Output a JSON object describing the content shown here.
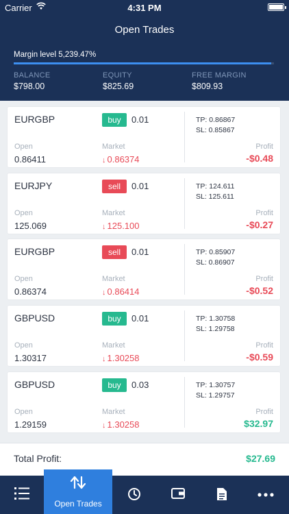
{
  "status": {
    "carrier": "Carrier",
    "time": "4:31 PM"
  },
  "header": {
    "title": "Open Trades",
    "margin_label": "Margin level 5,239.47%",
    "margin_fill_percent": 99,
    "stats": [
      {
        "label": "BALANCE",
        "value": "$798.00"
      },
      {
        "label": "EQUITY",
        "value": "$825.69"
      },
      {
        "label": "FREE MARGIN",
        "value": "$809.93"
      }
    ]
  },
  "labels": {
    "open": "Open",
    "market": "Market",
    "profit": "Profit"
  },
  "trades": [
    {
      "symbol": "EURGBP",
      "side": "buy",
      "lots": "0.01",
      "tp": "TP: 0.86867",
      "sl": "SL: 0.85867",
      "open": "0.86411",
      "market": "0.86374",
      "profit": "-$0.48",
      "profit_sign": "neg"
    },
    {
      "symbol": "EURJPY",
      "side": "sell",
      "lots": "0.01",
      "tp": "TP: 124.611",
      "sl": "SL: 125.611",
      "open": "125.069",
      "market": "125.100",
      "profit": "-$0.27",
      "profit_sign": "neg"
    },
    {
      "symbol": "EURGBP",
      "side": "sell",
      "lots": "0.01",
      "tp": "TP: 0.85907",
      "sl": "SL: 0.86907",
      "open": "0.86374",
      "market": "0.86414",
      "profit": "-$0.52",
      "profit_sign": "neg"
    },
    {
      "symbol": "GBPUSD",
      "side": "buy",
      "lots": "0.01",
      "tp": "TP: 1.30758",
      "sl": "SL: 1.29758",
      "open": "1.30317",
      "market": "1.30258",
      "profit": "-$0.59",
      "profit_sign": "neg"
    },
    {
      "symbol": "GBPUSD",
      "side": "buy",
      "lots": "0.03",
      "tp": "TP: 1.30757",
      "sl": "SL: 1.29757",
      "open": "1.29159",
      "market": "1.30258",
      "profit": "$32.97",
      "profit_sign": "pos"
    }
  ],
  "total": {
    "label": "Total Profit:",
    "value": "$27.69"
  },
  "tabs": [
    {
      "icon": "list-icon",
      "label": ""
    },
    {
      "icon": "transfer-arrows-icon",
      "label": "Open Trades",
      "active": true
    },
    {
      "icon": "clock-icon",
      "label": ""
    },
    {
      "icon": "wallet-icon",
      "label": ""
    },
    {
      "icon": "document-icon",
      "label": ""
    },
    {
      "icon": "more-icon",
      "label": ""
    }
  ],
  "colors": {
    "header_bg": "#1b3157",
    "accent": "#2f7fde",
    "buy": "#26b98f",
    "sell": "#e84a57",
    "profit_positive": "#26b98f",
    "profit_negative": "#e84a57"
  }
}
